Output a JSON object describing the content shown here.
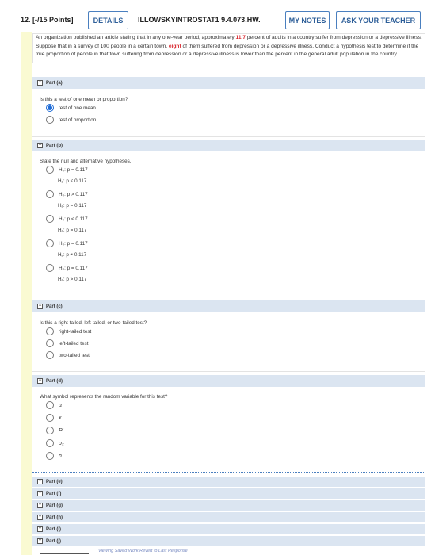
{
  "header": {
    "question_number": "12.",
    "points": "[-/15 Points]",
    "details_label": "DETAILS",
    "question_code": "ILLOWSKYINTROSTAT1 9.4.073.HW.",
    "my_notes_label": "MY NOTES",
    "ask_teacher_label": "ASK YOUR TEACHER"
  },
  "problem": {
    "text_1": "An organization published an article stating that in any one-year period, approximately ",
    "percent": "11.7",
    "text_2": " percent of adults in a country suffer from depression or a depressive illness. Suppose that in a survey of 100 people in a certain town, ",
    "count": "eight",
    "text_3": " of them suffered from depression or a depressive illness. Conduct a hypothesis test to determine if the true proportion of people in that town suffering from depression or a depressive illness is lower than the percent in the general adult population in the country."
  },
  "part_a": {
    "label": "Part (a)",
    "toggle": "−",
    "question": "Is this a test of one mean or proportion?",
    "options": [
      "test of one mean",
      "test of proportion"
    ],
    "selected": 0
  },
  "part_b": {
    "label": "Part (b)",
    "toggle": "−",
    "question": "State the null and alternative hypotheses.",
    "options": [
      {
        "h0": "H₀: p = 0.117",
        "ha": "Hₐ: p < 0.117"
      },
      {
        "h0": "H₀: p > 0.117",
        "ha": "Hₐ: p = 0.117"
      },
      {
        "h0": "H₀: p < 0.117",
        "ha": "Hₐ: p = 0.117"
      },
      {
        "h0": "H₀: p = 0.117",
        "ha": "Hₐ: p ≠ 0.117"
      },
      {
        "h0": "H₀: p = 0.117",
        "ha": "Hₐ: p > 0.117"
      }
    ]
  },
  "part_c": {
    "label": "Part (c)",
    "toggle": "−",
    "question": "Is this a right-tailed, left-tailed, or two-tailed test?",
    "options": [
      "right-tailed test",
      "left-tailed test",
      "two-tailed test"
    ]
  },
  "part_d": {
    "label": "Part (d)",
    "toggle": "−",
    "question": "What symbol represents the random variable for this test?",
    "options": [
      "α",
      "x",
      "P′",
      "σₓ",
      "n"
    ]
  },
  "collapsed_parts": [
    {
      "toggle": "+",
      "label": "Part (e)"
    },
    {
      "toggle": "+",
      "label": "Part (f)"
    },
    {
      "toggle": "+",
      "label": "Part (g)"
    },
    {
      "toggle": "+",
      "label": "Part (h)"
    },
    {
      "toggle": "+",
      "label": "Part (i)"
    },
    {
      "toggle": "+",
      "label": "Part (j)"
    }
  ],
  "footer": {
    "links": "Viewing Saved Work Revert to Last Response"
  },
  "colors": {
    "accent": "#2e5f99",
    "highlight": "#d9282f",
    "part_header_bg": "#dbe5f1",
    "left_bar": "#fafad2"
  }
}
